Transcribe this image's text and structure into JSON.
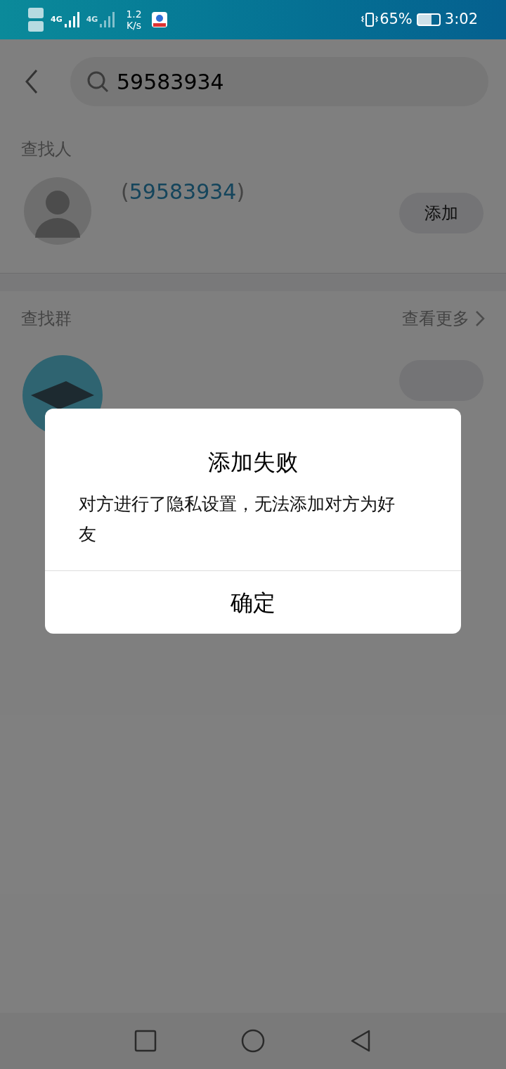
{
  "status_bar": {
    "network_1": "4G",
    "network_2": "4G",
    "speed_value": "1.2",
    "speed_unit": "K/s",
    "battery": "65%",
    "battery_meter": {
      "level": 0.65
    },
    "time": "3:02"
  },
  "search": {
    "value": "59583934"
  },
  "people_section": {
    "title": "查找人",
    "results": [
      {
        "prefix": "(",
        "number": "59583934",
        "suffix": ")",
        "button": "添加"
      }
    ]
  },
  "groups_section": {
    "title": "查找群",
    "more": "查看更多"
  },
  "dialog": {
    "title": "添加失败",
    "message": "对方进行了隐私设置，无法添加对方为好友",
    "confirm": "确定"
  }
}
